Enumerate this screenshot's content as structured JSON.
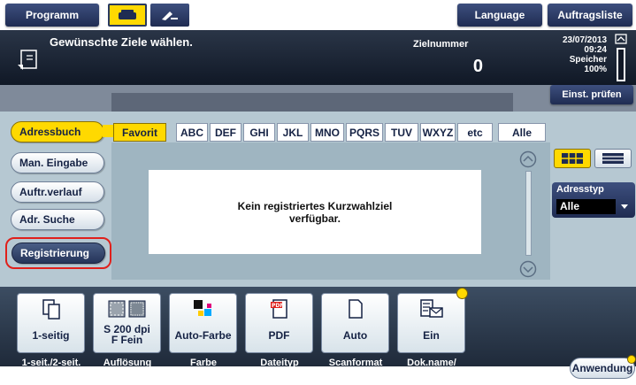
{
  "topbar": {
    "program_label": "Programm",
    "language_label": "Language",
    "joblist_label": "Auftragsliste",
    "tabs": [
      {
        "icon": "fax-icon"
      },
      {
        "icon": "handset-pen-icon"
      }
    ]
  },
  "message": {
    "icon": "document-destination-icon",
    "text": "Gewünschte Ziele wählen.",
    "destination_label": "Zielnummer",
    "destination_count": "0",
    "date": "23/07/2013",
    "time": "09:24",
    "memory_label": "Speicher",
    "memory_value": "100%",
    "memory_icon": "memory-gauge-icon"
  },
  "check_settings_label": "Einst. prüfen",
  "sidebar": {
    "items": [
      {
        "label": "Adressbuch",
        "active": true
      },
      {
        "label": "Man. Eingabe",
        "active": false
      },
      {
        "label": "Auftr.verlauf",
        "active": false
      },
      {
        "label": "Adr. Suche",
        "active": false
      },
      {
        "label": "Registrierung",
        "active": false,
        "highlighted": true
      }
    ]
  },
  "index_tabs": [
    "Favorit",
    "ABC",
    "DEF",
    "GHI",
    "JKL",
    "MNO",
    "PQRS",
    "TUV",
    "WXYZ",
    "etc",
    "Alle"
  ],
  "empty_message": {
    "line1": "Kein registriertes Kurzwahlziel",
    "line2": "verfügbar."
  },
  "address_type": {
    "label": "Adresstyp",
    "value": "Alle"
  },
  "view_toggle": {
    "grid_icon": "grid-view-icon",
    "list_icon": "list-view-icon"
  },
  "functions": [
    {
      "value": "1-seitig",
      "label": "1-seit./2-seit.",
      "icon": "duplex-icon"
    },
    {
      "value": "S 200 dpi\nF Fein",
      "label": "Auflösung",
      "icon": "resolution-icon"
    },
    {
      "value": "Auto-Farbe",
      "label": "Farbe",
      "icon": "color-icon"
    },
    {
      "value": "PDF",
      "label": "Dateityp",
      "icon": "pdf-icon"
    },
    {
      "value": "Auto",
      "label": "Scanformat",
      "icon": "scan-size-icon"
    },
    {
      "value": "Ein",
      "label": "Dok.name/\nBetr./And.",
      "icon": "document-name-icon"
    }
  ],
  "application_label": "Anwendung",
  "colors": {
    "navy": "#1f2c52",
    "active_yellow": "#ffd900",
    "highlight_red": "#e0201b",
    "panel_blue": "#b6c8d2"
  }
}
